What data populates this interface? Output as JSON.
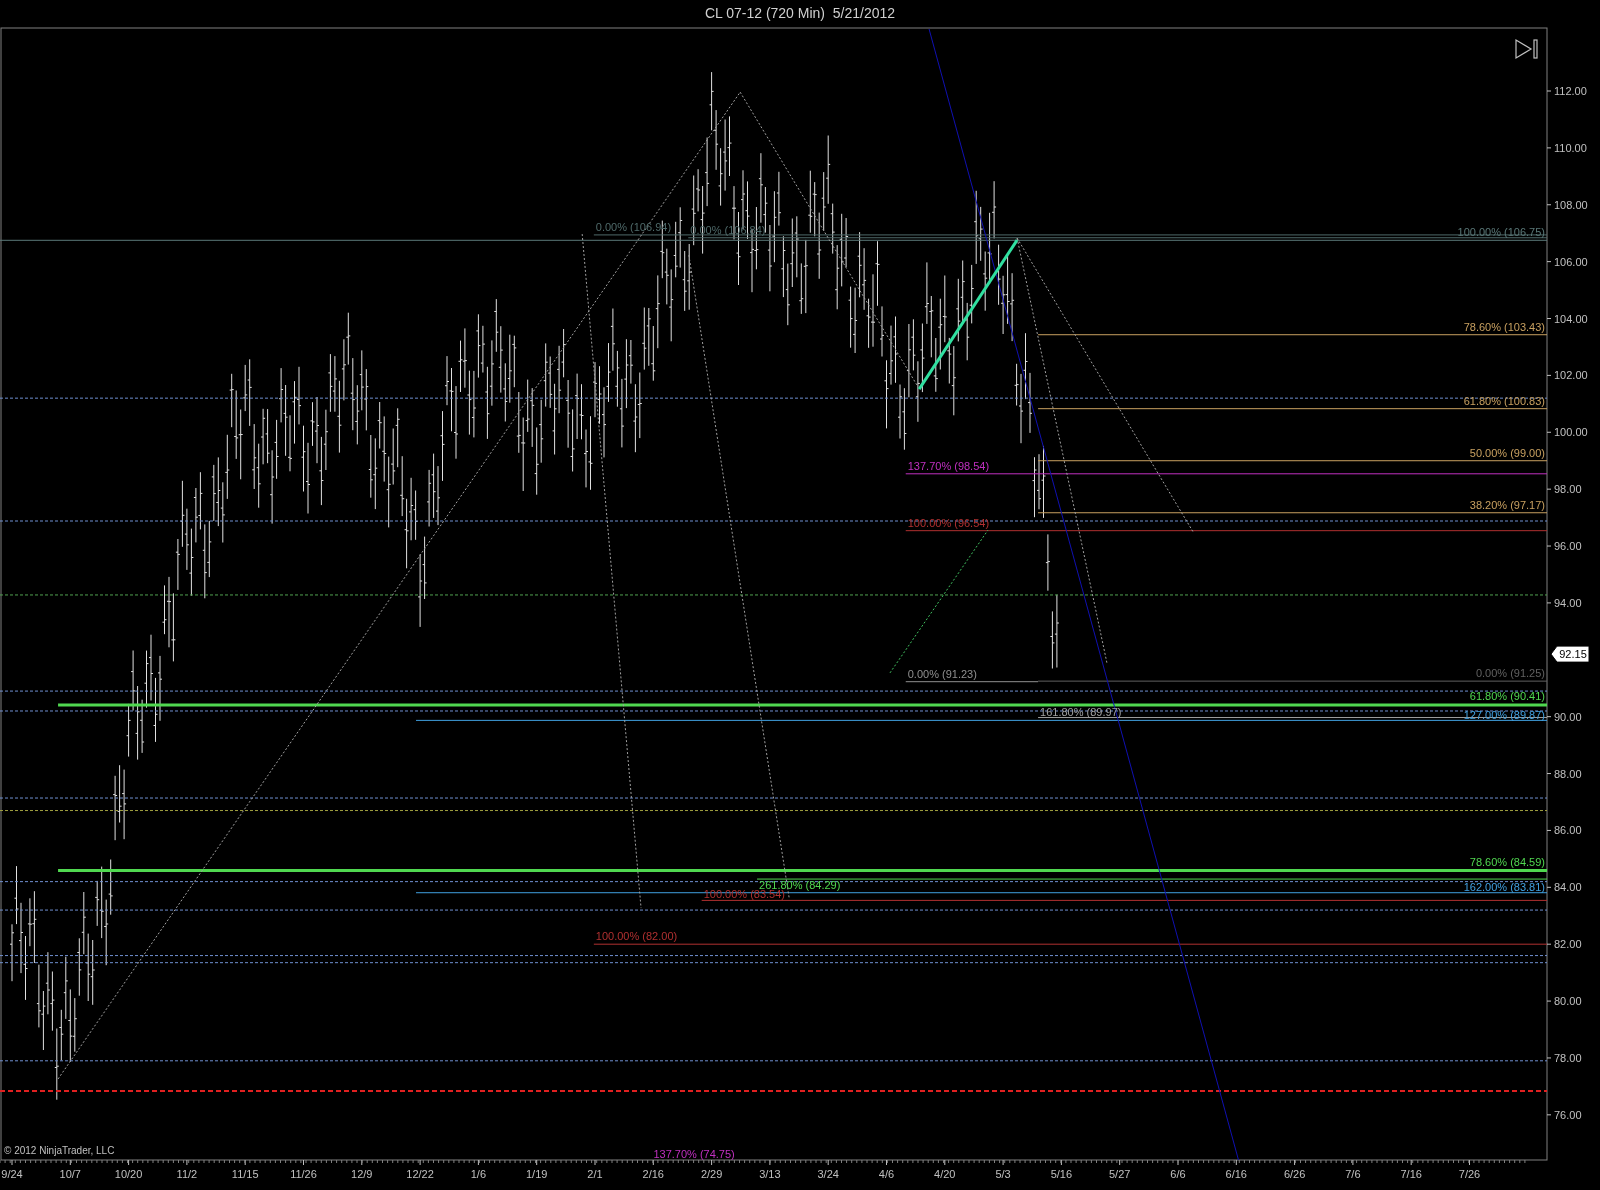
{
  "window": {
    "title": "CL 07-12 (720 Min)  5/21/2012"
  },
  "chart": {
    "fib_labels": [
      "0.00% (106.94)",
      "0.00% (106.84)",
      "100.00% (106.75)",
      "78.60% (103.43)",
      "61.80% (100.83)",
      "50.00% (99.00)",
      "137.70% (98.54)",
      "38.20% (97.17)",
      "100.00% (96.54)",
      "0.00% (91.23)",
      "0.00% (91.25)",
      "61.80% (90.41)",
      "161.80% (89.97)",
      "127.00% (89.87)",
      "78.60% (84.59)",
      "261.80% (84.29)",
      "162.00% (83.81)",
      "100.00% (83.54)",
      "100.00% (82.00)",
      "137.70% (74.75)"
    ],
    "price_marker": "92.15",
    "price_axis": [
      "112.00",
      "110.00",
      "108.00",
      "106.00",
      "104.00",
      "102.00",
      "100.00",
      "98.00",
      "96.00",
      "94.00",
      "90.00",
      "88.00",
      "86.00",
      "84.00",
      "82.00",
      "80.00",
      "78.00",
      "76.00"
    ],
    "date_axis": [
      "9/24",
      "10/7",
      "10/20",
      "11/2",
      "11/15",
      "11/26",
      "12/9",
      "12/22",
      "1/6",
      "1/19",
      "2/1",
      "2/16",
      "2/29",
      "3/13",
      "3/24",
      "4/6",
      "4/20",
      "5/3",
      "5/16",
      "5/27",
      "6/6",
      "6/16",
      "6/26",
      "7/6",
      "7/16",
      "7/26"
    ],
    "copyright": "© 2012 NinjaTrader, LLC"
  }
}
